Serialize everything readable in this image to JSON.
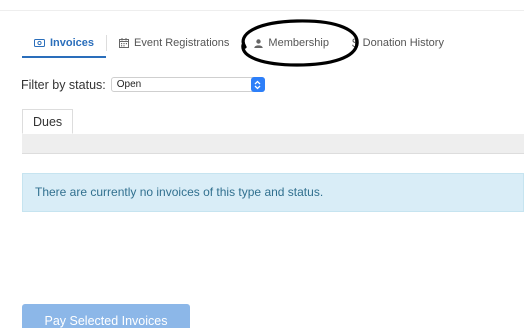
{
  "tabs": [
    {
      "label": "Invoices",
      "icon": "invoice-icon",
      "active": true
    },
    {
      "label": "Event Registrations",
      "icon": "calendar-icon",
      "active": false
    },
    {
      "label": "Membership",
      "icon": "user-icon",
      "active": false
    },
    {
      "label": "Donation History",
      "icon": "dollar-icon",
      "active": false
    }
  ],
  "filter": {
    "label": "Filter by status:",
    "selected": "Open"
  },
  "subtabs": [
    {
      "label": "Dues"
    }
  ],
  "alert": {
    "message": "There are currently no invoices of this type and status."
  },
  "pay_button": {
    "label": "Pay Selected Invoices"
  },
  "colors": {
    "accent": "#2a6ebb",
    "alert_bg": "#d9edf7",
    "alert_text": "#31708f",
    "button_disabled": "#8cb7e8",
    "select_accent": "#2d7ff9",
    "annotation": "#000000"
  }
}
